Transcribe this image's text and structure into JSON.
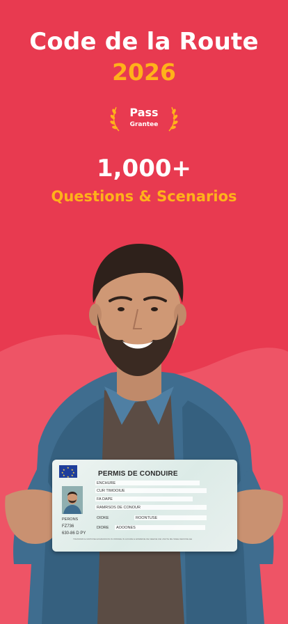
{
  "header": {
    "title": "Code de la Route",
    "year": "2026"
  },
  "badge": {
    "line1": "Pass",
    "line2": "Grantee"
  },
  "stats": {
    "count": "1,000+",
    "label": "Questions & Scenarios"
  },
  "license_card": {
    "title": "PERMIS DE CONDUIRE",
    "field_1": "ENCHURE",
    "field_2": "CUR  TIMOOIUE",
    "field_3": "FA  DAPE",
    "field_4": "RAMRSOS DE CONOUR",
    "field_5": "PERONS",
    "field_6": "OIOKE",
    "field_7": "ROONTUSE",
    "field_8": "FZ736",
    "field_9": "630-86  D  PY",
    "field_10": "DIORE",
    "field_11": "AOOONES",
    "footer": "TRANSMIN E MATIONE EXAMANNON IN OMSSIIE IN JAVURE E EMWEINE DE NEEINE ME UNUTE ME SNEE DEKKINE EE"
  },
  "colors": {
    "background": "#E83A50",
    "accent": "#FFB21A",
    "blob": "#EE5466"
  }
}
